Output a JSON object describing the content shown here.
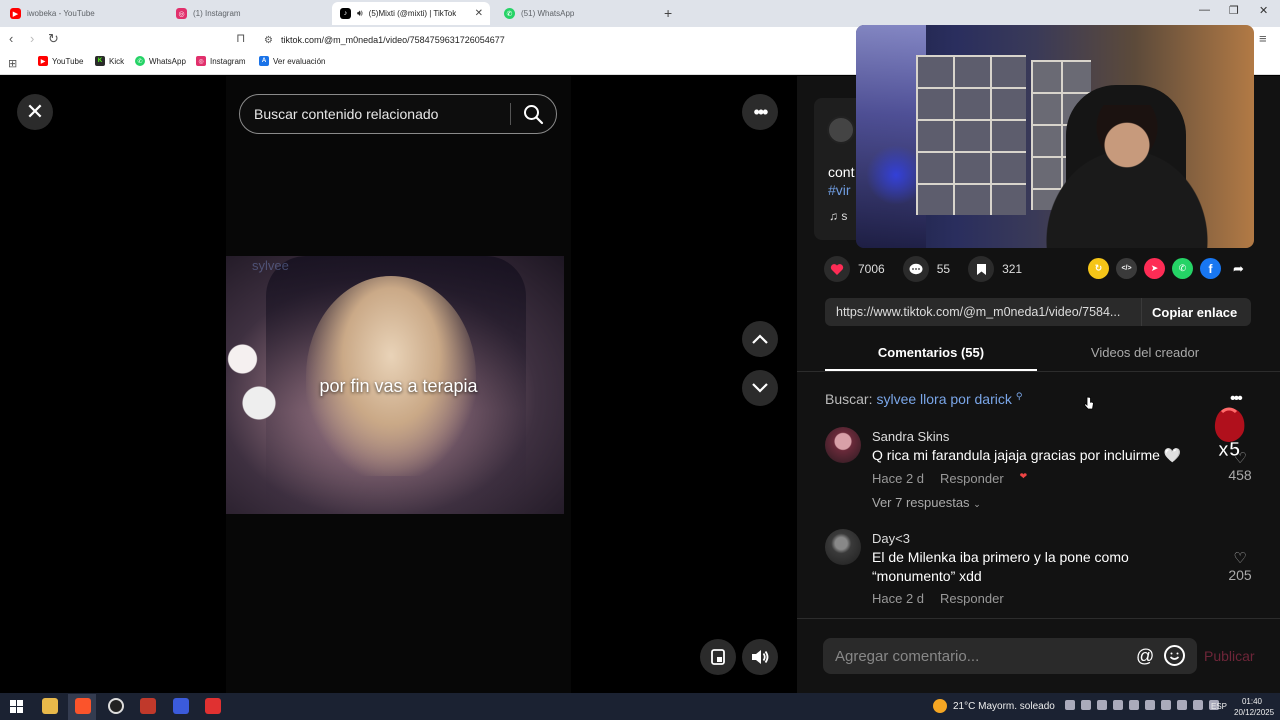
{
  "browser": {
    "tabs": [
      {
        "title": "iwobeka - YouTube",
        "favicon": "youtube-icon",
        "color": "#ff0000",
        "active": false
      },
      {
        "title": "(1) Instagram",
        "favicon": "instagram-icon",
        "color": "#e1306c",
        "active": false
      },
      {
        "title": "(5)Mixti (@mixti) | TikTok",
        "favicon": "tiktok-icon",
        "color": "#000000",
        "active": true
      },
      {
        "title": "(51) WhatsApp",
        "favicon": "whatsapp-icon",
        "color": "#25d366",
        "active": false
      }
    ],
    "new_tab": "+",
    "url": "tiktok.com/@m_m0neda1/video/7584759631726054677",
    "bookmarks": [
      {
        "label": "YouTube",
        "icon": "youtube-icon",
        "color": "#ff0000"
      },
      {
        "label": "Kick",
        "icon": "kick-icon",
        "color": "#2b2b2b"
      },
      {
        "label": "WhatsApp",
        "icon": "whatsapp-icon",
        "color": "#25d366"
      },
      {
        "label": "Instagram",
        "icon": "instagram-icon",
        "color": "#e1306c"
      },
      {
        "label": "Ver evaluación",
        "icon": "eval-icon",
        "color": "#1a73e8"
      }
    ]
  },
  "video": {
    "search_placeholder": "Buscar contenido relacionado",
    "caption": "por fin vas a terapia",
    "watermark": "sylvee"
  },
  "description": {
    "text_start": "cont",
    "tag_start": "#vir",
    "music_start": "s"
  },
  "actions": {
    "likes": "7006",
    "comments": "55",
    "saves": "321",
    "accent_like": "#fe2c55"
  },
  "share_buttons": [
    {
      "name": "repost-share-icon",
      "label": "↻",
      "color": "#f5c518"
    },
    {
      "name": "embed-share-icon",
      "label": "</>",
      "color": "#3a3a3a"
    },
    {
      "name": "send-share-icon",
      "label": "➤",
      "color": "#fe2c55"
    },
    {
      "name": "whatsapp-share-icon",
      "label": "✆",
      "color": "#25d366"
    },
    {
      "name": "facebook-share-icon",
      "label": "f",
      "color": "#1877f2"
    },
    {
      "name": "forward-share-icon",
      "label": "➦",
      "color": "transparent"
    }
  ],
  "link": {
    "url": "https://www.tiktok.com/@m_m0neda1/video/7584...",
    "copy_label": "Copiar enlace"
  },
  "tabs": {
    "comments": "Comentarios (55)",
    "creator_videos": "Videos del creador"
  },
  "search_related": {
    "prefix": "Buscar:",
    "query": "sylvee llora por darick"
  },
  "comments": [
    {
      "author": "Sandra Skins",
      "text": "Q rica mi farandula jajaja gracias por incluirme 🤍",
      "time": "Hace 2 d",
      "reply": "Responder",
      "likes": "458",
      "view_replies": "Ver 7 respuestas"
    },
    {
      "author": "Day<3",
      "text": "El de Milenka iba primero y la pone como “monumento” xdd",
      "time": "Hace 2 d",
      "reply": "Responder",
      "likes": "205"
    }
  ],
  "composer": {
    "placeholder": "Agregar comentario...",
    "publish": "Publicar"
  },
  "badge": "x5",
  "taskbar": {
    "weather": "21°C  Mayorm. soleado",
    "lang": "ESP",
    "time": "01:40",
    "date": "20/12/2025"
  }
}
